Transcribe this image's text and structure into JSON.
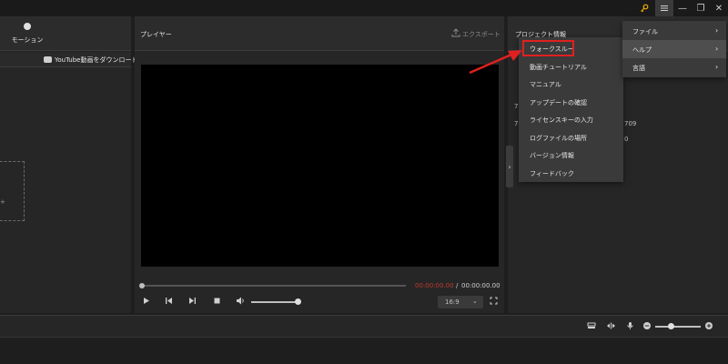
{
  "colors": {
    "accent_red": "#e02020",
    "timecode_red": "#c0392b",
    "key_icon": "#f0b400"
  },
  "window": {
    "key_icon": "key-icon",
    "menu_icon": "hamburger-icon",
    "minimize_glyph": "—",
    "maximize_glyph": "❐",
    "close_glyph": "✕"
  },
  "left_panel": {
    "motion_tab_label": "モーション",
    "youtube_download_label": "YouTube動画をダウンロード",
    "drop_plus_glyph": "+"
  },
  "player": {
    "title": "プレイヤー",
    "export_label": "エクスポート",
    "time_current": "00:00:00.00",
    "time_separator": "/",
    "time_total": "00:00:00.00",
    "aspect_ratio": "16:9",
    "seek_progress": 0,
    "volume_level": 0.95
  },
  "project_info": {
    "title": "プロジェクト情報",
    "partial_lines": [
      "7",
      "709",
      "7",
      "0"
    ]
  },
  "main_menu": {
    "items": [
      {
        "label": "ファイル",
        "has_submenu": true,
        "active": false
      },
      {
        "label": "ヘルプ",
        "has_submenu": true,
        "active": true
      },
      {
        "label": "言語",
        "has_submenu": true,
        "active": false
      }
    ]
  },
  "help_submenu": {
    "items": [
      "ウォークスルー",
      "動画チュートリアル",
      "マニュアル",
      "アップデートの確認",
      "ライセンスキーの入力",
      "ログファイルの場所",
      "バージョン情報",
      "フィードバック"
    ],
    "highlighted_index": 0
  },
  "timeline": {
    "zoom_level": 0.35
  }
}
